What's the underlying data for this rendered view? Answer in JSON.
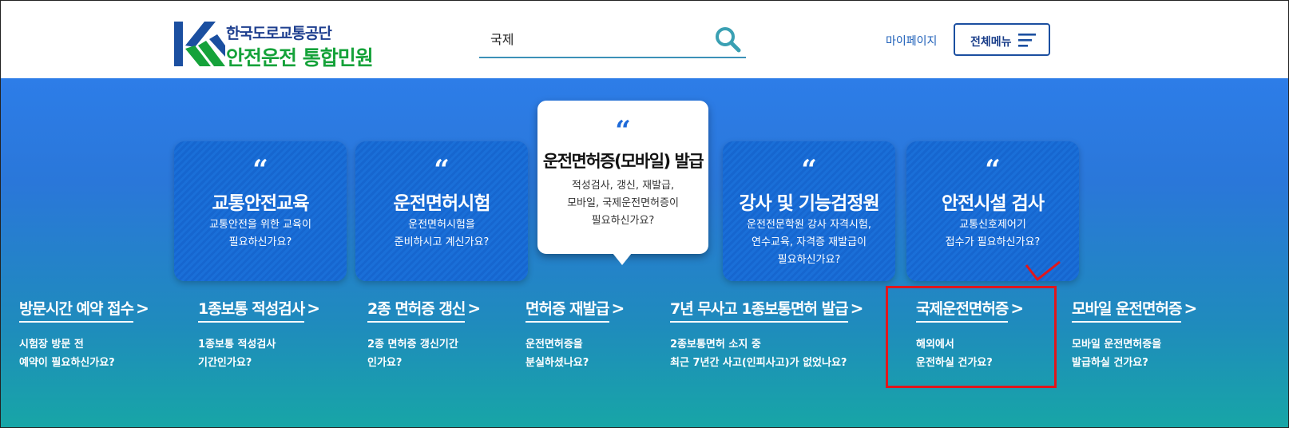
{
  "header": {
    "org_name": "한국도로교통공단",
    "service_name": "안전운전 통합민원",
    "search": {
      "value": "국제",
      "icon": "search-icon"
    },
    "mypage_label": "마이페이지",
    "menu_label": "전체메뉴",
    "menu_icon": "hamburger-icon"
  },
  "colors": {
    "brand_blue": "#1e3f8f",
    "brand_green": "#15a23a",
    "hero_top": "#2d7de8",
    "hero_bottom": "#17a6a6",
    "highlight": "#e0161c"
  },
  "cards": [
    {
      "quote": "“",
      "title": "교통안전교육",
      "desc_line1": "교통안전을 위한 교육이",
      "desc_line2": "필요하신가요?",
      "desc_line3": ""
    },
    {
      "quote": "“",
      "title": "운전면허시험",
      "desc_line1": "운전면허시험을",
      "desc_line2": "준비하시고 계신가요?",
      "desc_line3": ""
    },
    {
      "quote": "“",
      "title": "운전면허증(모바일) 발급",
      "desc_line1": "적성검사, 갱신, 재발급,",
      "desc_line2": "모바일, 국제운전면허증이",
      "desc_line3": "필요하신가요?"
    },
    {
      "quote": "“",
      "title": "강사 및 기능검정원",
      "desc_line1": "운전전문학원 강사 자격시험,",
      "desc_line2": "연수교육, 자격증 재발급이",
      "desc_line3": "필요하신가요?"
    },
    {
      "quote": "“",
      "title": "안전시설 검사",
      "desc_line1": "교통신호제어기",
      "desc_line2": "접수가 필요하신가요?",
      "desc_line3": ""
    }
  ],
  "quick_links": [
    {
      "title": "방문시간 예약 접수",
      "desc_line1": "시험장 방문 전",
      "desc_line2": "예약이 필요하신가요?"
    },
    {
      "title": "1종보통 적성검사",
      "desc_line1": "1종보통 적성검사",
      "desc_line2": "기간인가요?"
    },
    {
      "title": "2종 면허증 갱신",
      "desc_line1": "2종 면허증 갱신기간",
      "desc_line2": "인가요?"
    },
    {
      "title": "면허증 재발급",
      "desc_line1": "운전면허증을",
      "desc_line2": "분실하셨나요?"
    },
    {
      "title": "7년 무사고 1종보통면허 발급",
      "desc_line1": "2종보통면허 소지 중",
      "desc_line2": "최근 7년간 사고(인피사고)가 없었나요?"
    },
    {
      "title": "국제운전면허증",
      "desc_line1": "해외에서",
      "desc_line2": "운전하실 건가요?"
    },
    {
      "title": "모바일 운전면허증",
      "desc_line1": "모바일 운전면허증을",
      "desc_line2": "발급하실 건가요?"
    }
  ],
  "link_arrow": ">"
}
